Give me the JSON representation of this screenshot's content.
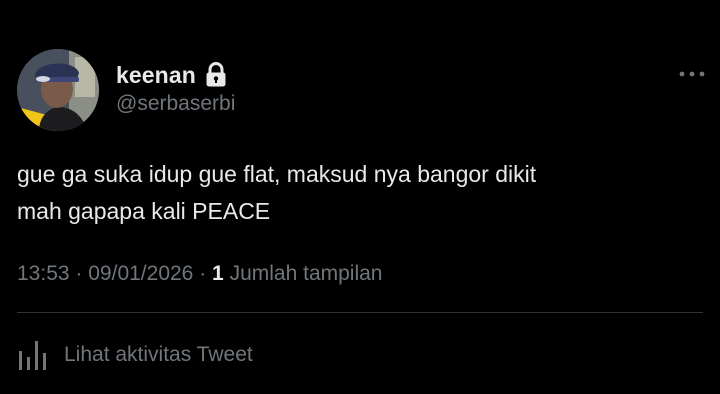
{
  "tweet": {
    "author": {
      "display_name": "keenan",
      "handle": "@serbaserbi",
      "protected_icon": "lock-icon",
      "avatar": "avatar"
    },
    "more_icon": "more-horizontal-icon",
    "text_lines": [
      "gue ga suka idup gue flat, maksud nya bangor dikit",
      "mah gapapa kali PEACE"
    ],
    "meta": {
      "time": "13:53",
      "separator": "·",
      "date": "09/01/2026",
      "views_count": "1",
      "views_label": "Jumlah tampilan"
    },
    "activity": {
      "icon": "analytics-icon",
      "label": "Lihat aktivitas Tweet"
    }
  },
  "colors": {
    "background": "#000000",
    "primary_text": "#e7e9ea",
    "secondary_text": "#71767b",
    "divider": "#2f3336"
  }
}
